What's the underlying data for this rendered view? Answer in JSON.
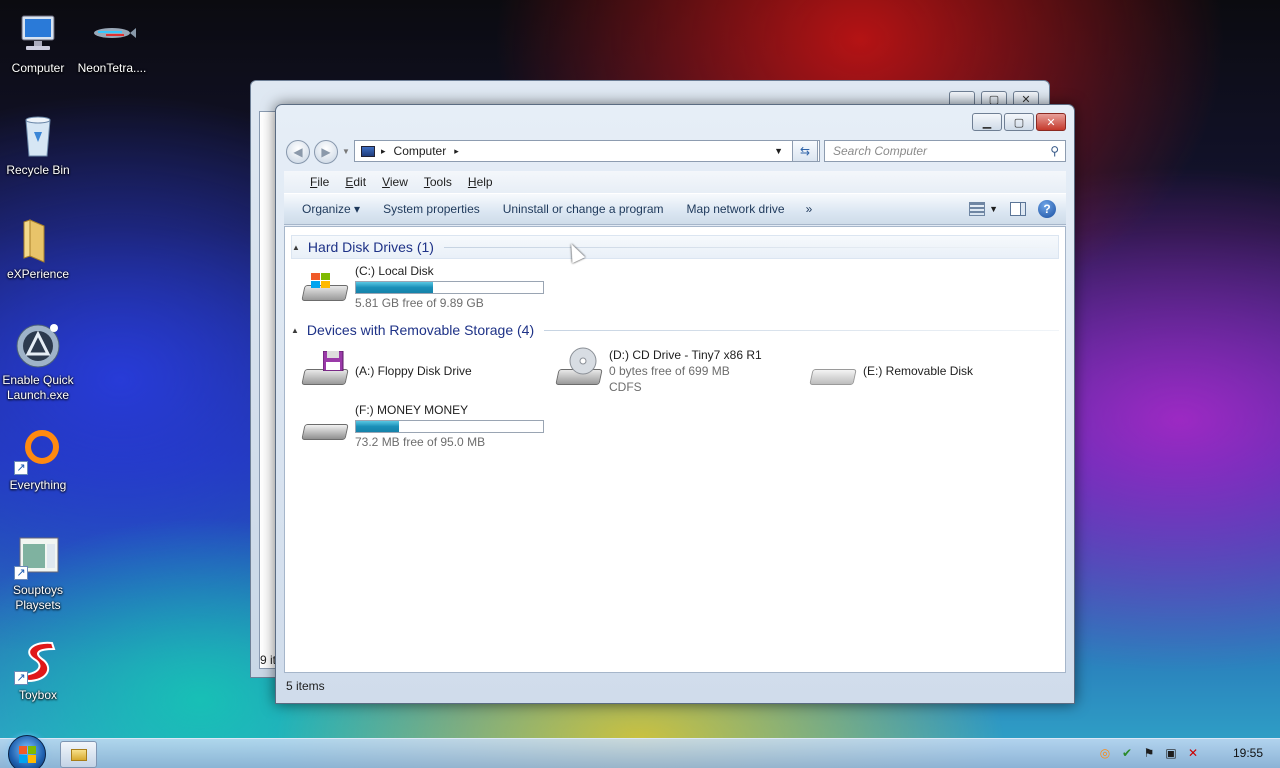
{
  "desktop": {
    "icons": [
      {
        "label": "Computer",
        "icon": "computer-icon"
      },
      {
        "label": "NeonTetra....",
        "icon": "fish-icon"
      },
      {
        "label": "Recycle Bin",
        "icon": "recycle-bin-icon"
      },
      {
        "label": "eXPerience",
        "icon": "folder-icon"
      },
      {
        "label": "Enable Quick Launch.exe",
        "icon": "app-icon"
      },
      {
        "label": "Everything",
        "icon": "search-app-icon"
      },
      {
        "label": "Souptoys Playsets",
        "icon": "app-window-icon"
      },
      {
        "label": "Toybox",
        "icon": "toybox-icon"
      }
    ]
  },
  "background_window": {
    "status": "9 it"
  },
  "explorer": {
    "controls": {
      "minimize": "▁",
      "maximize": "▢",
      "close": "✕"
    },
    "address": {
      "breadcrumb": "Computer",
      "separator": "▸"
    },
    "search": {
      "placeholder": "Search Computer"
    },
    "menu": [
      "File",
      "Edit",
      "View",
      "Tools",
      "Help"
    ],
    "commands": {
      "organize": "Organize ▾",
      "system_properties": "System properties",
      "uninstall": "Uninstall or change a program",
      "map_drive": "Map network drive",
      "more": "»"
    },
    "groups": [
      {
        "title": "Hard Disk Drives (1)"
      },
      {
        "title": "Devices with Removable Storage (4)"
      }
    ],
    "drives": {
      "c": {
        "name": "(C:) Local Disk",
        "free": "5.81 GB free of 9.89 GB",
        "used_fraction": 0.41
      },
      "a": {
        "name": "(A:) Floppy Disk Drive"
      },
      "d": {
        "name": "(D:) CD Drive - Tiny7 x86 R1",
        "free": "0 bytes free of 699 MB",
        "fs": "CDFS"
      },
      "e": {
        "name": "(E:) Removable Disk"
      },
      "f": {
        "name": "(F:) MONEY MONEY",
        "free": "73.2 MB free of 95.0 MB",
        "used_fraction": 0.23
      }
    },
    "status": "5 items"
  },
  "taskbar": {
    "clock": "19:55"
  },
  "colors": {
    "group_header": "#1e3287",
    "bar_fill": "#1a8fb8"
  }
}
